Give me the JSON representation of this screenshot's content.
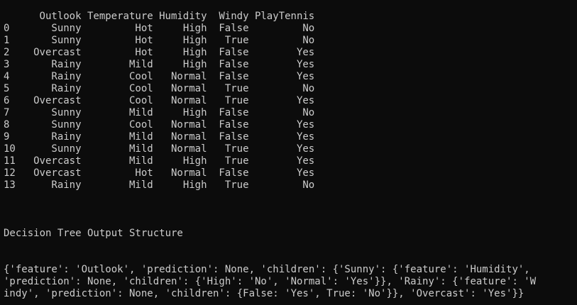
{
  "table": {
    "columns": [
      "Outlook",
      "Temperature",
      "Humidity",
      "Windy",
      "PlayTennis"
    ],
    "rows": [
      {
        "idx": "0",
        "outlook": "Sunny",
        "temperature": "Hot",
        "humidity": "High",
        "windy": "False",
        "play": "No"
      },
      {
        "idx": "1",
        "outlook": "Sunny",
        "temperature": "Hot",
        "humidity": "High",
        "windy": "True",
        "play": "No"
      },
      {
        "idx": "2",
        "outlook": "Overcast",
        "temperature": "Hot",
        "humidity": "High",
        "windy": "False",
        "play": "Yes"
      },
      {
        "idx": "3",
        "outlook": "Rainy",
        "temperature": "Mild",
        "humidity": "High",
        "windy": "False",
        "play": "Yes"
      },
      {
        "idx": "4",
        "outlook": "Rainy",
        "temperature": "Cool",
        "humidity": "Normal",
        "windy": "False",
        "play": "Yes"
      },
      {
        "idx": "5",
        "outlook": "Rainy",
        "temperature": "Cool",
        "humidity": "Normal",
        "windy": "True",
        "play": "No"
      },
      {
        "idx": "6",
        "outlook": "Overcast",
        "temperature": "Cool",
        "humidity": "Normal",
        "windy": "True",
        "play": "Yes"
      },
      {
        "idx": "7",
        "outlook": "Sunny",
        "temperature": "Mild",
        "humidity": "High",
        "windy": "False",
        "play": "No"
      },
      {
        "idx": "8",
        "outlook": "Sunny",
        "temperature": "Cool",
        "humidity": "Normal",
        "windy": "False",
        "play": "Yes"
      },
      {
        "idx": "9",
        "outlook": "Rainy",
        "temperature": "Mild",
        "humidity": "Normal",
        "windy": "False",
        "play": "Yes"
      },
      {
        "idx": "10",
        "outlook": "Sunny",
        "temperature": "Mild",
        "humidity": "Normal",
        "windy": "True",
        "play": "Yes"
      },
      {
        "idx": "11",
        "outlook": "Overcast",
        "temperature": "Mild",
        "humidity": "High",
        "windy": "True",
        "play": "Yes"
      },
      {
        "idx": "12",
        "outlook": "Overcast",
        "temperature": "Hot",
        "humidity": "Normal",
        "windy": "False",
        "play": "Yes"
      },
      {
        "idx": "13",
        "outlook": "Rainy",
        "temperature": "Mild",
        "humidity": "High",
        "windy": "True",
        "play": "No"
      }
    ]
  },
  "heading": "Decision Tree Output Structure",
  "output_lines": [
    "{'feature': 'Outlook', 'prediction': None, 'children': {'Sunny': {'feature': 'Humidity',",
    "'prediction': None, 'children': {'High': 'No', 'Normal': 'Yes'}}, 'Rainy': {'feature': 'W",
    "indy', 'prediction': None, 'children': {False: 'Yes', True: 'No'}}, 'Overcast': 'Yes'}}"
  ],
  "colors": {
    "background": "#0c0c0c",
    "text": "#cccccc"
  }
}
